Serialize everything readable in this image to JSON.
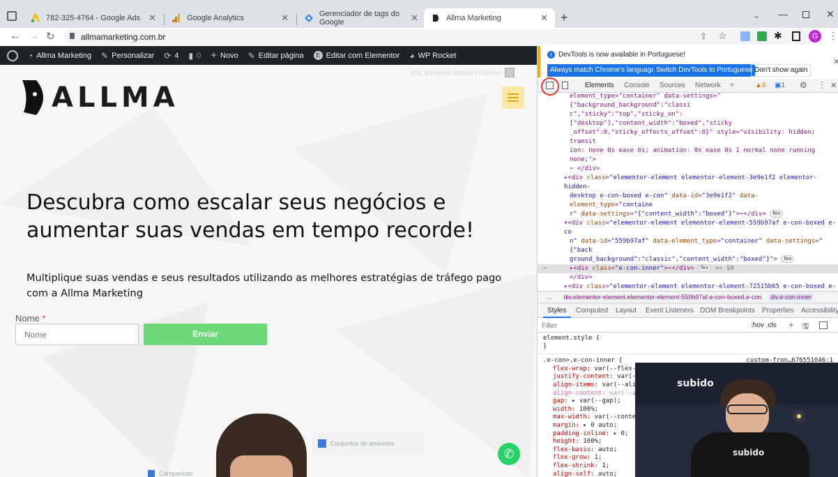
{
  "tabs": [
    {
      "label": "782-325-4764 - Google Ads",
      "icon": "google-ads-icon"
    },
    {
      "label": "Google Analytics",
      "icon": "google-analytics-icon"
    },
    {
      "label": "Gerenciador de tags do Google",
      "icon": "tag-manager-icon"
    },
    {
      "label": "Allma Marketing",
      "icon": "allma-icon",
      "active": true
    }
  ],
  "address": {
    "url": "allmamarketing.com.br"
  },
  "wpbar": {
    "site": "Allma Marketing",
    "customize": "Personalizar",
    "updates": "4",
    "comments": "0",
    "new": "Novo",
    "edit_page": "Editar página",
    "edit_elementor": "Editar com Elementor",
    "wp_rocket": "WP Rocket"
  },
  "site": {
    "logo_text": "ALLMA",
    "greeting": "Olá, Eduardo Adriano Farberi",
    "headline_1": "Descubra como escalar seus negócios e",
    "headline_2": "aumentar suas vendas em tempo recorde!",
    "sub_1": "Multiplique suas vendas e seus resultados utilizando as melhores estratégias de tráfego pago",
    "sub_2": "com a Allma Marketing",
    "name_label": "Nome",
    "required_mark": "*",
    "name_placeholder": "Nome",
    "submit": "Enviar",
    "card_1": "Conjuntos de anúncios",
    "card_2": "Campanhas"
  },
  "devtools": {
    "banner": "DevTools is now available in Portuguese!",
    "btn_match": "Always match Chrome's language",
    "btn_switch": "Switch DevTools to Portuguese",
    "btn_dismiss": "Don't show again",
    "tabs": [
      "Elements",
      "Console",
      "Sources",
      "Network",
      "»"
    ],
    "warnings": "6",
    "messages": "1",
    "breadcrumb_1": "div.elementor-element.elementor-element-559b97af.e-con-boxed.e-con",
    "breadcrumb_2": "div.e-con-inner",
    "style_tabs": [
      "Styles",
      "Computed",
      "Layout",
      "Event Listeners",
      "DOM Breakpoints",
      "Properties",
      "Accessibility"
    ],
    "filter_placeholder": "Filter",
    "filter_tools": ":hov  .cls",
    "element_style": "element.style {",
    "close_brace": "}",
    "rule_selector": ".e-con>.e-con-inner {",
    "rule_source": "custom-fron…676551046:1",
    "css_lines": [
      "flex-wrap: var(--flex-w",
      "justify-content: var(--",
      "align-items: var(--alig",
      "align-content: var(--a",
      "gap: ▸ var(--gap);",
      "width: 100%;",
      "max-width: var(--conte",
      "margin: ▸ 0 auto;",
      "padding-inline: ▸ 0;",
      "height: 100%;",
      "flex-basis: auto;",
      "flex-grow: 1;",
      "flex-shrink: 1;",
      "align-self: auto;"
    ]
  },
  "webcam": {
    "sign": "subido",
    "shirt": "subido"
  },
  "colors": {
    "accent_green": "#6ed97a",
    "brand_dark": "#1b1b1b",
    "chrome_blue": "#1a73e8"
  }
}
